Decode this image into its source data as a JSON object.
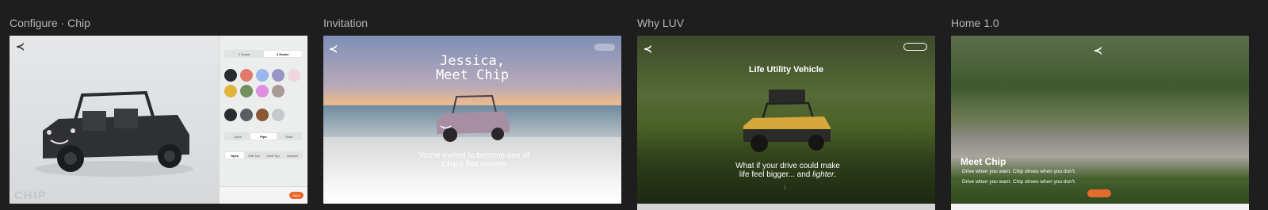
{
  "frames": [
    {
      "title": "Configure · Chip"
    },
    {
      "title": "Invitation"
    },
    {
      "title": "Why LUV"
    },
    {
      "title": "Home 1.0"
    }
  ],
  "configure": {
    "logo": "≺",
    "wordmark": "CHIP",
    "size_options": [
      "2 Seater",
      "4 Seater"
    ],
    "body_colors": [
      "#2a2b2e",
      "#e07a6d",
      "#9ab7ef",
      "#9a95c7",
      "#efd6de",
      "#e0b53a",
      "#73905c",
      "#df8fe0",
      "#a89b97"
    ],
    "wheels": [
      "#2b2c30",
      "#5a5d63",
      "#8b5a35",
      "#c7c8cc"
    ],
    "door_options": [
      "Open",
      "Pipe",
      "Solid"
    ],
    "top_options": [
      "Open",
      "Soft Top",
      "Hard Top",
      "Sunroof"
    ],
    "next_label": "Next"
  },
  "invitation": {
    "logo": "≺",
    "headline_1": "Jessica,",
    "headline_2": "Meet Chip",
    "body_1": "You're invited to become one of",
    "body_2": "Chip's first owners"
  },
  "whyluv": {
    "logo": "≺",
    "title": "Life Utility Vehicle",
    "body_1": "What if your drive could make",
    "body_2": "life feel bigger... and ",
    "body_italic": "lighter",
    "body_end": ".",
    "arrow": "↓"
  },
  "home": {
    "logo": "≺",
    "title": "Meet Chip",
    "sub_1": "Drive when you want. Chip drives when you don't.",
    "sub_2": "Drive when you want. Chip drives when you don't."
  }
}
